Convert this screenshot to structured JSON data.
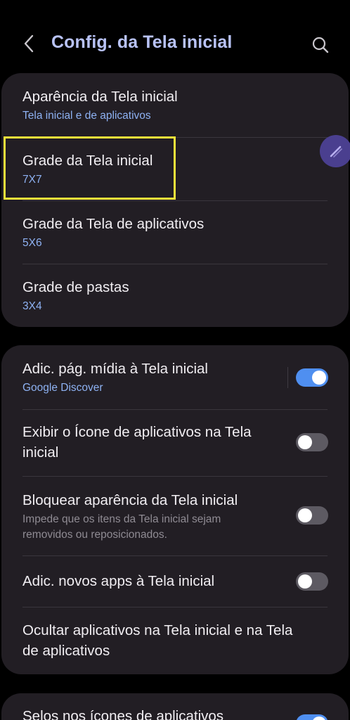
{
  "header": {
    "title": "Config. da Tela inicial",
    "back_icon": "back-arrow-icon",
    "search_icon": "search-icon"
  },
  "grid_section": {
    "items": [
      {
        "title": "Aparência da Tela inicial",
        "subtitle": "Tela inicial e de aplicativos"
      },
      {
        "title": "Grade da Tela inicial",
        "subtitle": "7X7"
      },
      {
        "title": "Grade da Tela de aplicativos",
        "subtitle": "5X6"
      },
      {
        "title": "Grade de pastas",
        "subtitle": "3X4"
      }
    ]
  },
  "options_section": {
    "items": [
      {
        "title": "Adic. pág. mídia à Tela inicial",
        "subtitle": "Google Discover",
        "toggle": true
      },
      {
        "title_line1": "Exibir o Ícone de aplicativos na Tela",
        "title_line2": "inicial",
        "toggle": false
      },
      {
        "title": "Bloquear aparência da Tela inicial",
        "description_line1": "Impede que os itens da Tela inicial sejam",
        "description_line2": "removidos ou reposicionados.",
        "toggle": false
      },
      {
        "title": "Adic. novos apps à Tela inicial",
        "toggle": false
      },
      {
        "title_line1": "Ocultar aplicativos na Tela inicial e na Tela",
        "title_line2": "de aplicativos"
      }
    ]
  },
  "badges_section": {
    "title": "Selos nos ícones de aplicativos",
    "toggle": true
  },
  "colors": {
    "accent": "#4f8ff0",
    "highlight": "#f4e33a",
    "card": "#221e24",
    "title": "#b9c3f7"
  }
}
